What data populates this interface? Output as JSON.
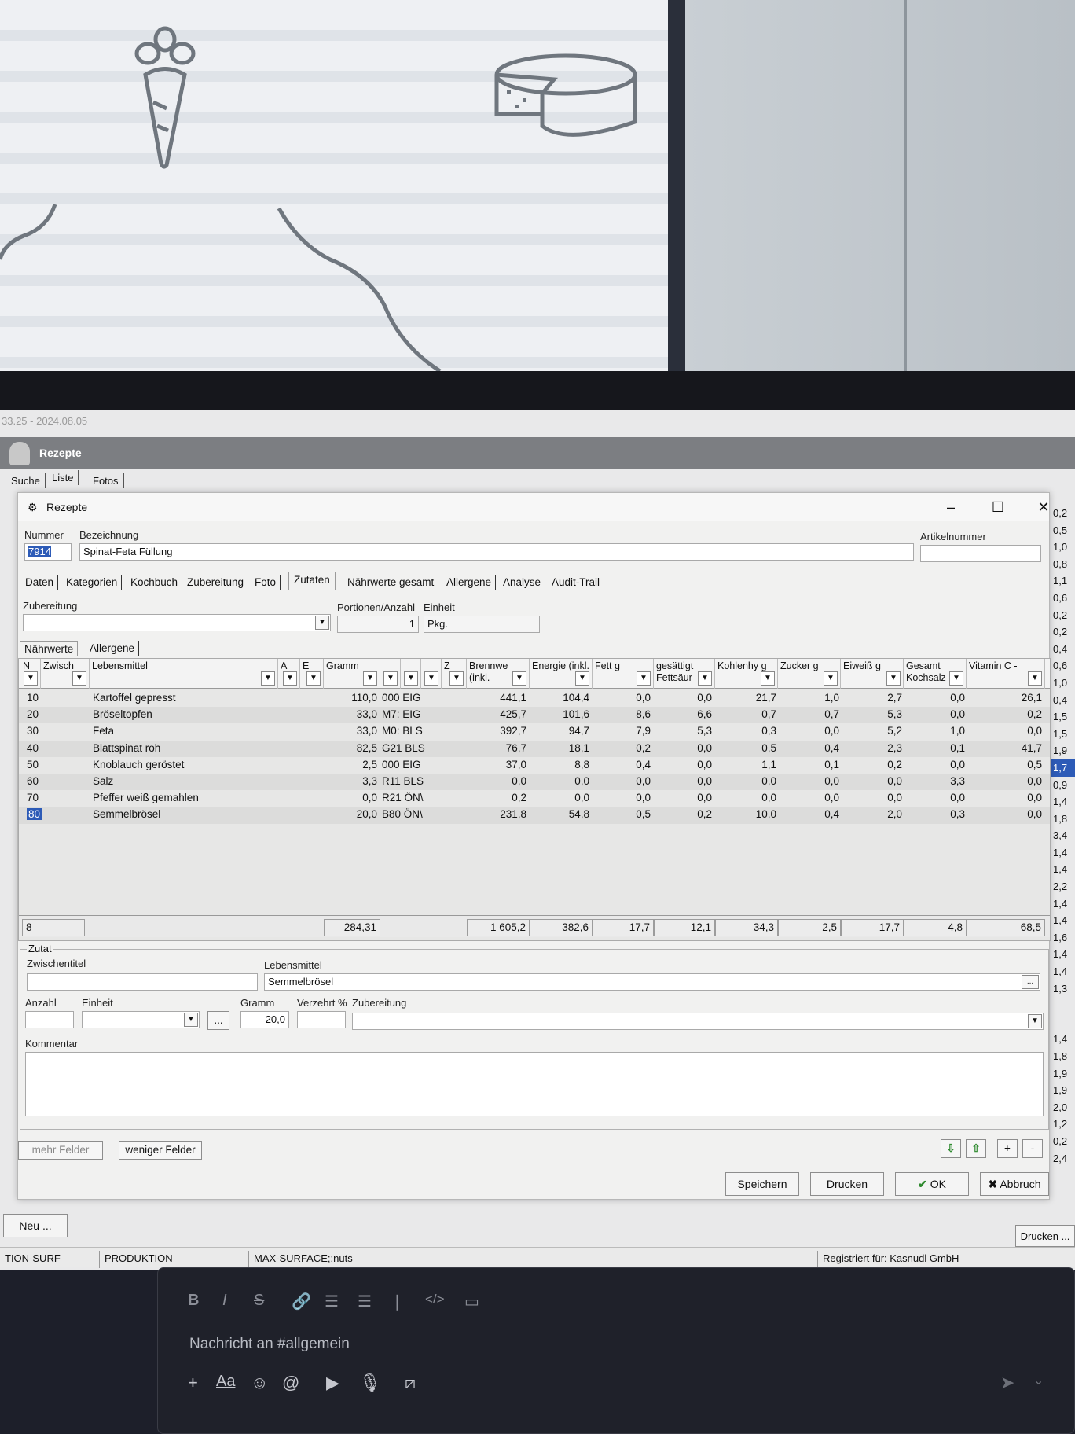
{
  "app": {
    "version_title": "33.25 - 2024.08.05",
    "header_title": "Rezepte",
    "top_tabs": [
      "Suche",
      "Liste",
      "Fotos"
    ],
    "right_column_values": [
      "0,2",
      "0,5",
      "1,0",
      "0,8",
      "1,1",
      "0,6",
      "0,2",
      "0,2",
      "0,4",
      "0,6",
      "1,0",
      "0,4",
      "1,5",
      "1,5",
      "1,9",
      "1,7",
      "0,9",
      "1,4",
      "1,8",
      "3,4",
      "1,4",
      "1,4",
      "2,2",
      "1,4",
      "1,4",
      "1,6",
      "1,4",
      "1,4",
      "1,3",
      "",
      "",
      "1,4",
      "1,8",
      "1,9",
      "1,9",
      "2,0",
      "1,2",
      "0,2",
      "2,4"
    ],
    "neu_button": "Neu ...",
    "drucken_button": "Drucken ..."
  },
  "dialog": {
    "title": "Rezepte",
    "labels": {
      "nummer": "Nummer",
      "bezeichnung": "Bezeichnung",
      "artikelnummer": "Artikelnummer",
      "zubereitung": "Zubereitung",
      "portionen": "Portionen/Anzahl",
      "einheit": "Einheit"
    },
    "values": {
      "nummer": "7914",
      "bezeichnung": "Spinat-Feta Füllung",
      "artikelnummer": "",
      "zubereitung": "",
      "portionen": "1",
      "einheit": "Pkg."
    },
    "tabs": [
      "Daten",
      "Kategorien",
      "Kochbuch",
      "Zubereitung",
      "Foto",
      "Zutaten",
      "Nährwerte gesamt",
      "Allergene",
      "Analyse",
      "Audit-Trail"
    ],
    "active_tab": "Zutaten",
    "subtabs": [
      "Nährwerte",
      "Allergene"
    ],
    "grid": {
      "columns": [
        "N",
        "Zwisch",
        "Lebensmittel",
        "A",
        "E",
        "Gramm",
        "",
        "",
        "",
        "Z",
        "Brennwe (inkl.",
        "Energie (inkl.",
        "Fett g",
        "gesättigt Fettsäur",
        "Kohlenhy g",
        "Zucker g",
        "Eiweiß g",
        "Gesamt Kochsalz",
        "Vitamin C -"
      ],
      "rows": [
        {
          "pos": "10",
          "name": "Kartoffel gepresst",
          "gramm": "110,0",
          "code": "000 EIG",
          "brennwert": "441,1",
          "energie": "104,4",
          "fett": "0,0",
          "gesfett": "0,0",
          "kh": "21,7",
          "zucker": "1,0",
          "eiweiss": "2,7",
          "salz": "0,0",
          "vitc": "26,1"
        },
        {
          "pos": "20",
          "name": "Bröseltopfen",
          "gramm": "33,0",
          "code": "M7: EIG",
          "brennwert": "425,7",
          "energie": "101,6",
          "fett": "8,6",
          "gesfett": "6,6",
          "kh": "0,7",
          "zucker": "0,7",
          "eiweiss": "5,3",
          "salz": "0,0",
          "vitc": "0,2"
        },
        {
          "pos": "30",
          "name": "Feta",
          "gramm": "33,0",
          "code": "M0: BLS",
          "brennwert": "392,7",
          "energie": "94,7",
          "fett": "7,9",
          "gesfett": "5,3",
          "kh": "0,3",
          "zucker": "0,0",
          "eiweiss": "5,2",
          "salz": "1,0",
          "vitc": "0,0"
        },
        {
          "pos": "40",
          "name": "Blattspinat roh",
          "gramm": "82,5",
          "code": "G21 BLS",
          "brennwert": "76,7",
          "energie": "18,1",
          "fett": "0,2",
          "gesfett": "0,0",
          "kh": "0,5",
          "zucker": "0,4",
          "eiweiss": "2,3",
          "salz": "0,1",
          "vitc": "41,7"
        },
        {
          "pos": "50",
          "name": "Knoblauch geröstet",
          "gramm": "2,5",
          "code": "000 EIG",
          "brennwert": "37,0",
          "energie": "8,8",
          "fett": "0,4",
          "gesfett": "0,0",
          "kh": "1,1",
          "zucker": "0,1",
          "eiweiss": "0,2",
          "salz": "0,0",
          "vitc": "0,5"
        },
        {
          "pos": "60",
          "name": "Salz",
          "gramm": "3,3",
          "code": "R11 BLS",
          "brennwert": "0,0",
          "energie": "0,0",
          "fett": "0,0",
          "gesfett": "0,0",
          "kh": "0,0",
          "zucker": "0,0",
          "eiweiss": "0,0",
          "salz": "3,3",
          "vitc": "0,0"
        },
        {
          "pos": "70",
          "name": "Pfeffer weiß gemahlen",
          "gramm": "0,0",
          "code": "R21 ÖN\\",
          "brennwert": "0,2",
          "energie": "0,0",
          "fett": "0,0",
          "gesfett": "0,0",
          "kh": "0,0",
          "zucker": "0,0",
          "eiweiss": "0,0",
          "salz": "0,0",
          "vitc": "0,0"
        },
        {
          "pos": "80",
          "name": "Semmelbrösel",
          "gramm": "20,0",
          "code": "B80 ÖN\\",
          "brennwert": "231,8",
          "energie": "54,8",
          "fett": "0,5",
          "gesfett": "0,2",
          "kh": "10,0",
          "zucker": "0,4",
          "eiweiss": "2,0",
          "salz": "0,3",
          "vitc": "0,0"
        }
      ],
      "footer": {
        "count": "8",
        "gramm": "284,31",
        "brennwert": "1 605,2",
        "energie": "382,6",
        "fett": "17,7",
        "gesfett": "12,1",
        "kh": "34,3",
        "zucker": "2,5",
        "eiweiss": "17,7",
        "salz": "4,8",
        "vitc": "68,5"
      }
    },
    "zutat": {
      "group_title": "Zutat",
      "labels": {
        "zwischentitel": "Zwischentitel",
        "lebensmittel": "Lebensmittel",
        "anzahl": "Anzahl",
        "einheit": "Einheit",
        "gramm": "Gramm",
        "verzehrt": "Verzehrt %",
        "zubereitung": "Zubereitung",
        "kommentar": "Kommentar"
      },
      "values": {
        "zwischentitel": "",
        "lebensmittel": "Semmelbrösel",
        "anzahl": "",
        "einheit": "",
        "gramm": "20,0",
        "verzehrt": "",
        "zubereitung": "",
        "kommentar": ""
      }
    },
    "buttons": {
      "mehr_felder": "mehr Felder",
      "weniger_felder": "weniger Felder",
      "plus": "+",
      "minus": "-",
      "speichern": "Speichern",
      "drucken": "Drucken",
      "ok": "OK",
      "abbruch": "Abbruch",
      "ellipsis": "..."
    }
  },
  "statusbar": [
    "TION-SURF",
    "PRODUKTION",
    "MAX-SURFACE;:nuts",
    "Registriert für: Kasnudl GmbH"
  ],
  "composer": {
    "placeholder": "Nachricht an #allgemein",
    "format_tools": [
      "B",
      "I",
      "S"
    ],
    "aa_label": "Aa"
  }
}
